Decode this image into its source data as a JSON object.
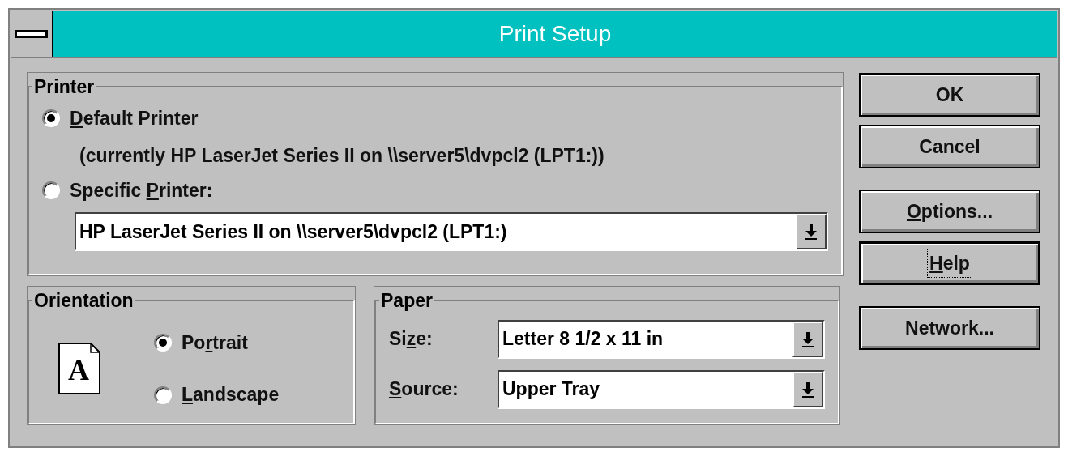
{
  "window": {
    "title": "Print Setup"
  },
  "printer": {
    "title": "Printer",
    "options": [
      {
        "label": {
          "key": "D",
          "post": "efault Printer"
        },
        "selected": true,
        "note": "(currently HP LaserJet Series II on \\\\server5\\dvpcl2 (LPT1:))"
      },
      {
        "label": {
          "pre": "Specific ",
          "key": "P",
          "post": "rinter:"
        },
        "selected": false
      }
    ],
    "printer_select": {
      "value": "HP LaserJet Series II on \\\\server5\\dvpcl2 (LPT1:)"
    }
  },
  "orientation": {
    "title": "Orientation",
    "preview_letter": "A",
    "options": [
      {
        "label": {
          "pre": "Po",
          "key": "r",
          "post": "trait"
        },
        "selected": true
      },
      {
        "label": {
          "key": "L",
          "post": "andscape"
        },
        "selected": false
      }
    ]
  },
  "paper": {
    "title": "Paper",
    "fields": [
      {
        "label": {
          "pre": "Si",
          "key": "z",
          "post": "e:"
        },
        "value": "Letter 8 1/2 x 11 in"
      },
      {
        "label": {
          "key": "S",
          "post": "ource:"
        },
        "value": "Upper Tray"
      }
    ]
  },
  "buttons": [
    {
      "label": {
        "pre": "OK"
      },
      "default": false,
      "focused": false
    },
    {
      "label": {
        "pre": "Cancel"
      },
      "default": false,
      "focused": false
    },
    {
      "label": {
        "key": "O",
        "post": "ptions..."
      },
      "default": false,
      "focused": false
    },
    {
      "label": {
        "key": "H",
        "post": "elp"
      },
      "default": true,
      "focused": true
    },
    {
      "label": {
        "pre": "Network..."
      },
      "default": false,
      "focused": false
    }
  ]
}
